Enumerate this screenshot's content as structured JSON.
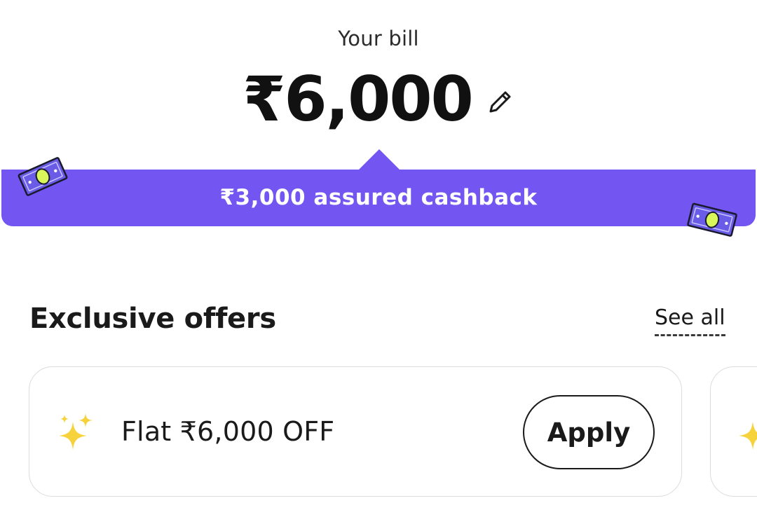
{
  "bill": {
    "label": "Your bill",
    "amount": "₹6,000",
    "edit_icon": "pencil-icon"
  },
  "cashback": {
    "text": "₹3,000 assured cashback",
    "accent_color": "#7356f1",
    "decor_icon": "money-note-icon"
  },
  "offers": {
    "title": "Exclusive offers",
    "see_all_label": "See all",
    "items": [
      {
        "icon": "sparkle-icon",
        "text": "Flat ₹6,000 OFF",
        "apply_label": "Apply"
      }
    ]
  }
}
